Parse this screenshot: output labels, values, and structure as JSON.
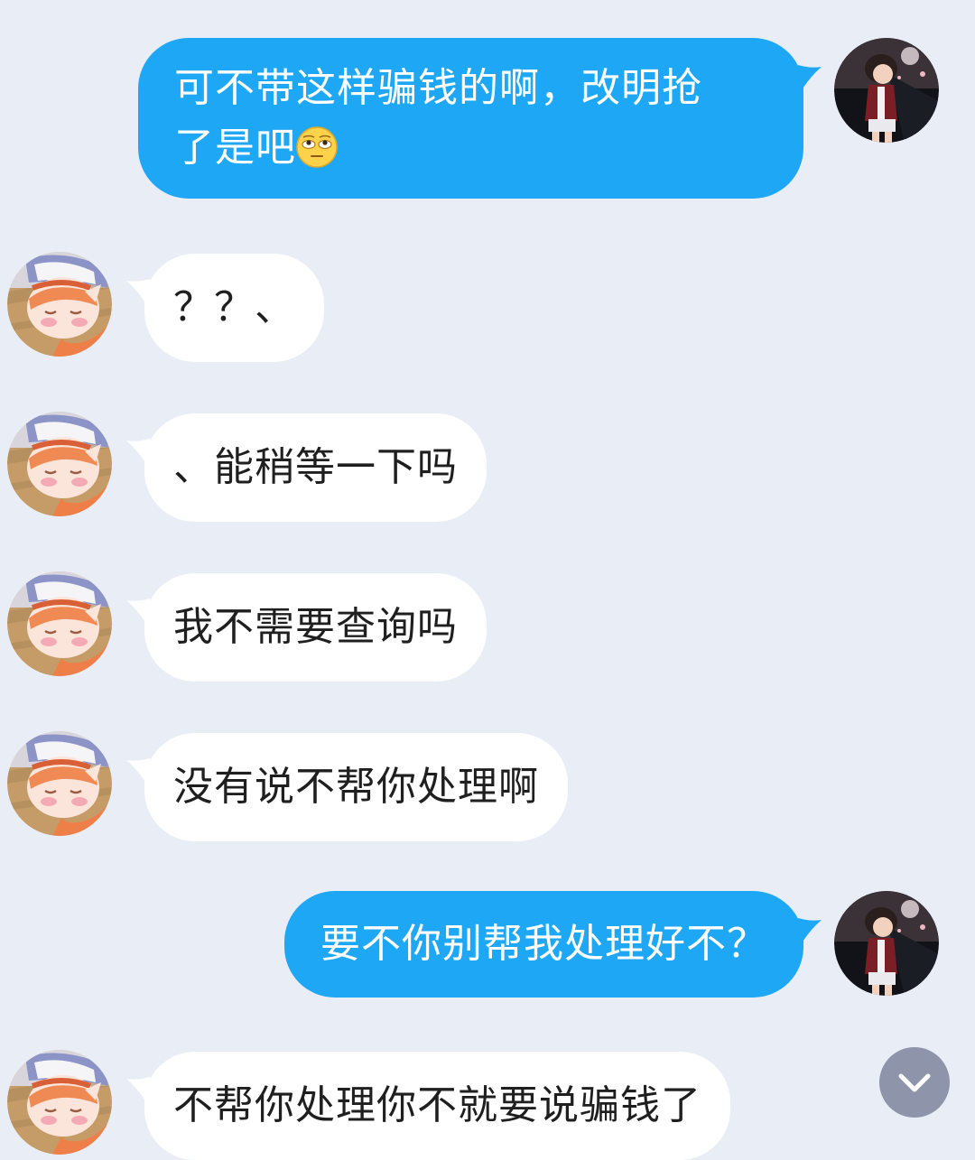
{
  "colors": {
    "background": "#e9edf5",
    "outgoing_bubble": "#1ea7f4",
    "incoming_bubble": "#ffffff",
    "scroll_button": "#8e94aa"
  },
  "messages": [
    {
      "sender": "me",
      "line1": "可不带这样骗钱的啊，改明抢",
      "line2": "了是吧",
      "emoji": "rolling-eyes-emoji"
    },
    {
      "sender": "other",
      "text": "？？、"
    },
    {
      "sender": "other",
      "text": "、能稍等一下吗"
    },
    {
      "sender": "other",
      "text": "我不需要查询吗"
    },
    {
      "sender": "other",
      "text": "没有说不帮你处理啊"
    },
    {
      "sender": "me",
      "text": "要不你别帮我处理好不？"
    },
    {
      "sender": "other",
      "text": "不帮你处理你不就要说骗钱了"
    }
  ],
  "scroll_button": {
    "icon": "chevron-down-icon"
  }
}
